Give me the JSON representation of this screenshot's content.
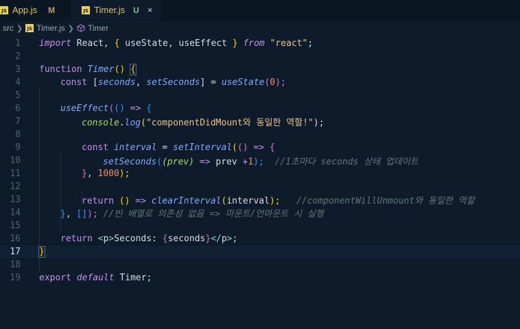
{
  "tabs": [
    {
      "icon": "JS",
      "name": "App.js",
      "status": "M",
      "active": false
    },
    {
      "icon": "JS",
      "name": "Timer.js",
      "status": "U",
      "active": true,
      "close": "×"
    }
  ],
  "breadcrumb": {
    "folder": "src",
    "file": "Timer.js",
    "symbol": "Timer"
  },
  "editor": {
    "current_line": 17,
    "line_numbers": [
      "1",
      "2",
      "3",
      "4",
      "5",
      "6",
      "7",
      "8",
      "9",
      "10",
      "11",
      "12",
      "13",
      "14",
      "15",
      "16",
      "17",
      "18",
      "19"
    ],
    "code": {
      "l1": [
        "import",
        " React, ",
        "{",
        " useState, useEffect ",
        "}",
        " from ",
        "\"react\"",
        ";"
      ],
      "l3": [
        "function",
        " ",
        "Timer",
        "()",
        " ",
        "{"
      ],
      "l4": [
        "const",
        " [",
        "seconds",
        ", ",
        "setSeconds",
        "] = ",
        "useState",
        "(",
        "0",
        ");"
      ],
      "l6": [
        "useEffect",
        "(",
        "()",
        " => ",
        "{"
      ],
      "l7": [
        "console",
        ".",
        "log",
        "(",
        "\"componentDidMount와 동일한 역할!\"",
        ");"
      ],
      "l9": [
        "const",
        " ",
        "interval",
        " = ",
        "setInterval",
        "(",
        "()",
        " => ",
        "{"
      ],
      "l10": [
        "setSeconds",
        "(",
        "(prev)",
        " => ",
        "prev ",
        "+",
        "1",
        ");",
        "  ",
        "//1초마다 seconds 상태 업데이트"
      ],
      "l11": [
        "}",
        ", ",
        "1000",
        ");"
      ],
      "l13": [
        "return",
        " ",
        "()",
        " => ",
        "clearInterval",
        "(",
        "interval",
        ");",
        "   ",
        "//componentWillUnmount와 동일한 역할"
      ],
      "l14": [
        "}",
        ", ",
        "[]",
        ");",
        " ",
        "//빈 배열로 의존성 없음 => 마운트/언마운트 시 실행"
      ],
      "l16": [
        "return",
        " ",
        "<",
        "p",
        ">",
        "Seconds: ",
        "{",
        "seconds",
        "}",
        "</",
        "p",
        ">",
        ";"
      ],
      "l17": [
        "}"
      ],
      "l19": [
        "export",
        " ",
        "default",
        " Timer;"
      ]
    }
  }
}
